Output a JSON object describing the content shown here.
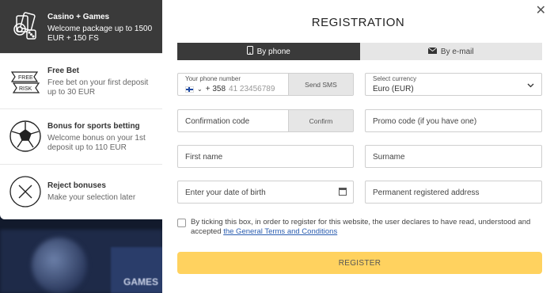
{
  "background": {
    "games_label": "GAMES"
  },
  "bonuses": [
    {
      "icon": "casino-cards-dice-icon",
      "title": "Casino + Games",
      "desc": "Welcome package up to 1500 EUR + 150 FS",
      "active": true
    },
    {
      "icon": "free-bet-ticket-icon",
      "title": "Free Bet",
      "desc": "Free bet on your first deposit up to 30 EUR",
      "icon_text_top": "FREE",
      "icon_text_bottom": "RISK",
      "active": false
    },
    {
      "icon": "soccer-ball-icon",
      "title": "Bonus for sports betting",
      "desc": "Welcome bonus on your 1st deposit up to 110 EUR",
      "active": false
    },
    {
      "icon": "reject-x-icon",
      "title": "Reject bonuses",
      "desc": "Make your selection later",
      "active": false
    }
  ],
  "modal": {
    "close": "✕",
    "title": "REGISTRATION",
    "tabs": [
      {
        "label": "By phone",
        "icon": "phone-icon",
        "active": true
      },
      {
        "label": "By e-mail",
        "icon": "envelope-icon",
        "active": false
      }
    ],
    "phone": {
      "label": "Your phone number",
      "code": "+ 358",
      "placeholder": "41 23456789",
      "send_sms": "Send SMS"
    },
    "currency": {
      "label": "Select currency",
      "value": "Euro (EUR)"
    },
    "confirmation": {
      "placeholder": "Confirmation code",
      "button": "Confirm"
    },
    "promo": {
      "placeholder": "Promo code (if you have one)"
    },
    "first_name": {
      "placeholder": "First name"
    },
    "surname": {
      "placeholder": "Surname"
    },
    "dob": {
      "placeholder": "Enter your date of birth"
    },
    "address": {
      "placeholder": "Permanent registered address"
    },
    "terms": {
      "text": "By ticking this box, in order to register for this website, the user declares to have read, understood and accepted",
      "link": "the General Terms and Conditions"
    },
    "register": "REGISTER"
  }
}
